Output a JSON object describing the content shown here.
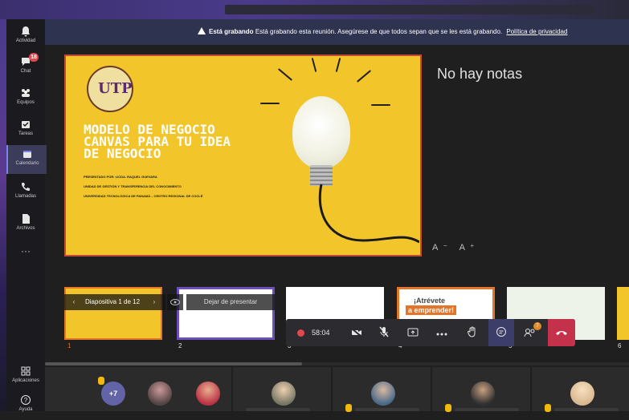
{
  "rail": {
    "items": [
      {
        "label": "Actividad",
        "icon": "bell-icon"
      },
      {
        "label": "Chat",
        "icon": "chat-icon",
        "badge": "18"
      },
      {
        "label": "Equipos",
        "icon": "teams-icon"
      },
      {
        "label": "Tareas",
        "icon": "tasks-icon"
      },
      {
        "label": "Calendario",
        "icon": "calendar-icon",
        "active": true
      },
      {
        "label": "Llamadas",
        "icon": "phone-icon"
      },
      {
        "label": "Archivos",
        "icon": "file-icon"
      }
    ],
    "more": "···",
    "apps_label": "Aplicaciones",
    "help_label": "Ayuda"
  },
  "banner": {
    "bold": "Está grabando",
    "message": "Está grabando esta reunión. Asegúrese de que todos sepan que se les está grabando.",
    "link": "Política de privacidad"
  },
  "slide": {
    "logo_text": "UTP",
    "title": "MODELO DE NEGOCIO CANVAS PARA TU IDEA DE NEGOCIO",
    "presented_by": "PRESENTADO POR: LICDA. RAQUEL GUEVARA",
    "unit": "UNIDAD DE GESTIÓN Y TRANSFERENCIA DEL CONOCIMIENTO",
    "university": "UNIVERSIDAD TECNOLÓGICA DE PANAMÁ – CENTRO REGIONAL DE COCLÉ"
  },
  "notes": {
    "empty_text": "No hay notas",
    "font_controls": "A⁻ A⁺"
  },
  "slidenav": {
    "label": "Diapositiva 1 de 12",
    "prev": "‹",
    "next": "›",
    "stop": "Dejar de presentar"
  },
  "thumbnails": {
    "numbers": [
      "1",
      "2",
      "3",
      "4",
      "5",
      "6"
    ],
    "t4_line1": "¡Atrévete",
    "t4_line2": "a emprender!"
  },
  "callbar": {
    "timer": "58:04",
    "participants_badge": "7"
  },
  "participants": {
    "more": "+7"
  },
  "colors": {
    "accent": "#6264a7",
    "hangup": "#c4314b",
    "slide_bg": "#f2c62b",
    "banner": "#2e3350"
  }
}
